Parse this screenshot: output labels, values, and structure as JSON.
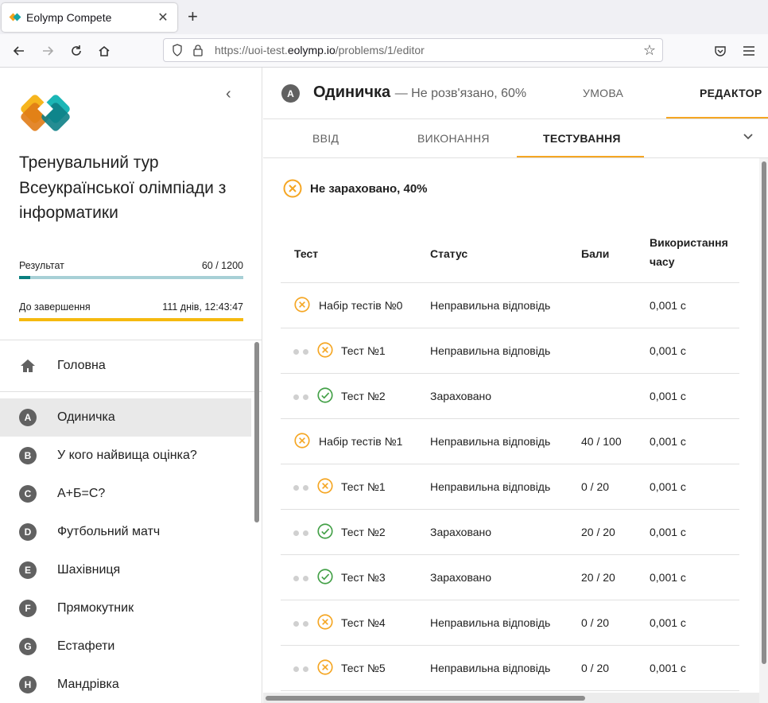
{
  "browser": {
    "tab_title": "Eolymp Compete",
    "tab_close": "✕",
    "new_tab": "+",
    "url_prefix": "https://uoi-test.",
    "url_host": "eolymp.io",
    "url_path": "/problems/1/editor"
  },
  "sidebar": {
    "contest_title": "Тренувальний тур Всеукраїнської олімпіади з інформатики",
    "result_label": "Результат",
    "result_value": "60 / 1200",
    "result_progress": 0.05,
    "remaining_label": "До завершення",
    "remaining_value": "111 днів, 12:43:47",
    "home_label": "Головна",
    "items": [
      {
        "letter": "A",
        "label": "Одиничка"
      },
      {
        "letter": "B",
        "label": "У кого найвища оцінка?"
      },
      {
        "letter": "C",
        "label": "А+Б=С?"
      },
      {
        "letter": "D",
        "label": "Футбольний матч"
      },
      {
        "letter": "E",
        "label": "Шахівниця"
      },
      {
        "letter": "F",
        "label": "Прямокутник"
      },
      {
        "letter": "G",
        "label": "Естафети"
      },
      {
        "letter": "H",
        "label": "Мандрівка"
      }
    ]
  },
  "problem": {
    "letter": "A",
    "name": "Одиничка",
    "status": "— Не розв'язано, 60%",
    "tabs": [
      "УМОВА",
      "РЕДАКТОР"
    ]
  },
  "subtabs": [
    "ВВІД",
    "ВИКОНАННЯ",
    "ТЕСТУВАННЯ"
  ],
  "verdict": "Не зараховано, 40%",
  "table": {
    "headers": {
      "test": "Тест",
      "status": "Статус",
      "score": "Бали",
      "time_1": "Використання",
      "time_2": "часу"
    },
    "rows": [
      {
        "name": "Набір тестів №0",
        "status": "Неправильна відповідь",
        "score": "",
        "time": "0,001 с",
        "ok": false,
        "child": false
      },
      {
        "name": "Тест №1",
        "status": "Неправильна відповідь",
        "score": "",
        "time": "0,001 с",
        "ok": false,
        "child": true
      },
      {
        "name": "Тест №2",
        "status": "Зараховано",
        "score": "",
        "time": "0,001 с",
        "ok": true,
        "child": true
      },
      {
        "name": "Набір тестів №1",
        "status": "Неправильна відповідь",
        "score": "40 / 100",
        "time": "0,001 с",
        "ok": false,
        "child": false
      },
      {
        "name": "Тест №1",
        "status": "Неправильна відповідь",
        "score": "0 / 20",
        "time": "0,001 с",
        "ok": false,
        "child": true
      },
      {
        "name": "Тест №2",
        "status": "Зараховано",
        "score": "20 / 20",
        "time": "0,001 с",
        "ok": true,
        "child": true
      },
      {
        "name": "Тест №3",
        "status": "Зараховано",
        "score": "20 / 20",
        "time": "0,001 с",
        "ok": true,
        "child": true
      },
      {
        "name": "Тест №4",
        "status": "Неправильна відповідь",
        "score": "0 / 20",
        "time": "0,001 с",
        "ok": false,
        "child": true
      },
      {
        "name": "Тест №5",
        "status": "Неправильна відповідь",
        "score": "0 / 20",
        "time": "0,001 с",
        "ok": false,
        "child": true
      }
    ]
  },
  "colors": {
    "accent": "#f5a623",
    "fail": "#f5a623",
    "ok": "#43a047",
    "teal": "#0a7f7f",
    "badge": "#616161"
  }
}
